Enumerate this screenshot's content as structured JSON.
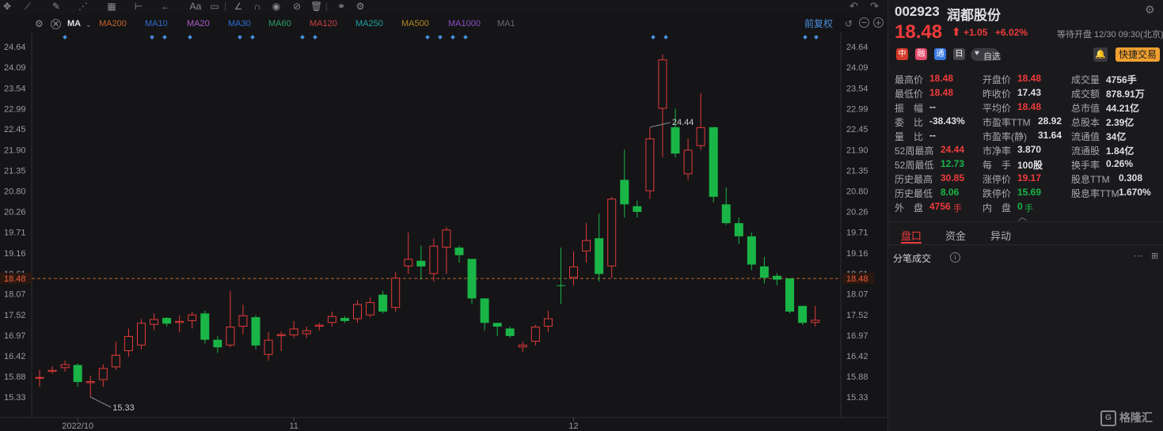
{
  "toolbar": {
    "icons": [
      "crosshair-icon",
      "line-icon",
      "pencil-icon",
      "polyline-icon",
      "range-icon",
      "arrow-icon",
      "measure-icon",
      "text-icon",
      "comment-icon",
      "brush-icon",
      "magnet-icon",
      "eye-icon",
      "hide-icon",
      "delete-icon",
      "link-icon",
      "settings-icon"
    ],
    "text_label": "Aa"
  },
  "ma_row": {
    "ma_select": "MA",
    "items": [
      {
        "label": "MA200",
        "color": "#c8642b"
      },
      {
        "label": "MA10",
        "color": "#2f6fd0"
      },
      {
        "label": "MA20",
        "color": "#a85fc8"
      },
      {
        "label": "MA30",
        "color": "#2f6fd0"
      },
      {
        "label": "MA60",
        "color": "#2f9f6a"
      },
      {
        "label": "MA120",
        "color": "#c84040"
      },
      {
        "label": "MA250",
        "color": "#1fa0a0"
      },
      {
        "label": "MA500",
        "color": "#b08a20"
      },
      {
        "label": "MA1000",
        "color": "#8a4fc8"
      },
      {
        "label": "MA1",
        "color": "#6a6a70"
      }
    ],
    "adjust_label": "前复权"
  },
  "chart_data": {
    "type": "candlestick",
    "y_ticks": [
      "24.64",
      "24.09",
      "23.54",
      "22.99",
      "22.45",
      "21.90",
      "21.35",
      "20.80",
      "20.26",
      "19.71",
      "19.16",
      "18.61",
      "18.07",
      "17.52",
      "16.97",
      "16.42",
      "15.88",
      "15.33"
    ],
    "ylim": [
      14.8,
      25.0
    ],
    "current_price_label": "18.48",
    "current_price": 18.48,
    "x_labels": [
      {
        "label": "2022/10",
        "index": 3
      },
      {
        "label": "11",
        "index": 20
      },
      {
        "label": "12",
        "index": 42
      }
    ],
    "annotations": [
      {
        "label": "15.33",
        "index": 4
      },
      {
        "label": "24.44",
        "index": 48
      }
    ],
    "candles": [
      {
        "o": 15.82,
        "c": 15.86,
        "h": 16.05,
        "l": 15.6
      },
      {
        "o": 16.0,
        "c": 16.05,
        "h": 16.15,
        "l": 15.95
      },
      {
        "o": 16.1,
        "c": 16.2,
        "h": 16.3,
        "l": 16.0
      },
      {
        "o": 16.18,
        "c": 15.73,
        "h": 16.22,
        "l": 15.6
      },
      {
        "o": 15.7,
        "c": 15.75,
        "h": 15.9,
        "l": 15.33
      },
      {
        "o": 15.78,
        "c": 16.1,
        "h": 16.2,
        "l": 15.6
      },
      {
        "o": 16.12,
        "c": 16.45,
        "h": 16.8,
        "l": 16.05
      },
      {
        "o": 16.55,
        "c": 16.95,
        "h": 17.15,
        "l": 16.4
      },
      {
        "o": 16.7,
        "c": 17.3,
        "h": 17.4,
        "l": 16.6
      },
      {
        "o": 17.25,
        "c": 17.4,
        "h": 17.55,
        "l": 17.1
      },
      {
        "o": 17.43,
        "c": 17.28,
        "h": 17.45,
        "l": 17.2
      },
      {
        "o": 17.3,
        "c": 17.35,
        "h": 17.5,
        "l": 17.05
      },
      {
        "o": 17.35,
        "c": 17.52,
        "h": 17.6,
        "l": 17.15
      },
      {
        "o": 17.55,
        "c": 16.85,
        "h": 17.62,
        "l": 16.75
      },
      {
        "o": 16.85,
        "c": 16.65,
        "h": 16.95,
        "l": 16.5
      },
      {
        "o": 16.7,
        "c": 17.2,
        "h": 18.15,
        "l": 16.65
      },
      {
        "o": 17.2,
        "c": 17.5,
        "h": 17.78,
        "l": 17.0
      },
      {
        "o": 17.45,
        "c": 16.7,
        "h": 17.5,
        "l": 16.6
      },
      {
        "o": 16.45,
        "c": 16.85,
        "h": 17.05,
        "l": 16.3
      },
      {
        "o": 16.95,
        "c": 17.0,
        "h": 17.07,
        "l": 16.55
      },
      {
        "o": 16.97,
        "c": 17.15,
        "h": 17.35,
        "l": 16.9
      },
      {
        "o": 17.0,
        "c": 17.1,
        "h": 17.2,
        "l": 16.9
      },
      {
        "o": 17.2,
        "c": 17.25,
        "h": 17.3,
        "l": 17.1
      },
      {
        "o": 17.3,
        "c": 17.48,
        "h": 17.6,
        "l": 17.2
      },
      {
        "o": 17.43,
        "c": 17.35,
        "h": 17.48,
        "l": 17.3
      },
      {
        "o": 17.4,
        "c": 17.8,
        "h": 17.9,
        "l": 17.3
      },
      {
        "o": 17.5,
        "c": 17.85,
        "h": 17.98,
        "l": 17.45
      },
      {
        "o": 18.05,
        "c": 17.6,
        "h": 18.15,
        "l": 17.55
      },
      {
        "o": 17.7,
        "c": 18.5,
        "h": 18.65,
        "l": 17.6
      },
      {
        "o": 18.8,
        "c": 19.0,
        "h": 19.7,
        "l": 18.6
      },
      {
        "o": 18.95,
        "c": 18.8,
        "h": 19.35,
        "l": 18.45
      },
      {
        "o": 18.6,
        "c": 19.35,
        "h": 19.55,
        "l": 18.4
      },
      {
        "o": 19.3,
        "c": 19.78,
        "h": 19.85,
        "l": 18.6
      },
      {
        "o": 19.3,
        "c": 19.1,
        "h": 19.35,
        "l": 18.9
      },
      {
        "o": 19.0,
        "c": 17.95,
        "h": 19.0,
        "l": 17.8
      },
      {
        "o": 17.95,
        "c": 17.3,
        "h": 17.95,
        "l": 17.1
      },
      {
        "o": 17.3,
        "c": 17.2,
        "h": 17.3,
        "l": 16.95
      },
      {
        "o": 17.15,
        "c": 16.95,
        "h": 17.2,
        "l": 16.9
      },
      {
        "o": 16.65,
        "c": 16.72,
        "h": 16.8,
        "l": 16.52
      },
      {
        "o": 16.8,
        "c": 17.2,
        "h": 17.25,
        "l": 16.7
      },
      {
        "o": 17.2,
        "c": 17.42,
        "h": 17.62,
        "l": 17.05
      },
      {
        "o": 18.3,
        "c": 18.28,
        "h": 19.3,
        "l": 17.8
      },
      {
        "o": 18.5,
        "c": 18.8,
        "h": 19.2,
        "l": 18.3
      },
      {
        "o": 19.2,
        "c": 19.5,
        "h": 19.95,
        "l": 18.9
      },
      {
        "o": 19.55,
        "c": 18.6,
        "h": 20.2,
        "l": 18.4
      },
      {
        "o": 18.8,
        "c": 20.6,
        "h": 20.65,
        "l": 18.5
      },
      {
        "o": 21.1,
        "c": 20.45,
        "h": 21.9,
        "l": 20.1
      },
      {
        "o": 20.4,
        "c": 20.25,
        "h": 20.55,
        "l": 20.1
      },
      {
        "o": 20.8,
        "c": 22.2,
        "h": 22.5,
        "l": 20.6
      },
      {
        "o": 22.99,
        "c": 24.3,
        "h": 24.44,
        "l": 21.7
      },
      {
        "o": 22.5,
        "c": 21.8,
        "h": 22.99,
        "l": 21.7
      },
      {
        "o": 21.25,
        "c": 21.9,
        "h": 22.2,
        "l": 21.1
      },
      {
        "o": 22.0,
        "c": 22.5,
        "h": 23.4,
        "l": 21.9
      },
      {
        "o": 22.5,
        "c": 20.65,
        "h": 22.5,
        "l": 20.5
      },
      {
        "o": 20.45,
        "c": 19.95,
        "h": 20.9,
        "l": 19.9
      },
      {
        "o": 19.95,
        "c": 19.6,
        "h": 20.1,
        "l": 19.4
      },
      {
        "o": 19.6,
        "c": 18.85,
        "h": 19.7,
        "l": 18.7
      },
      {
        "o": 18.8,
        "c": 18.5,
        "h": 19.05,
        "l": 18.35
      },
      {
        "o": 18.55,
        "c": 18.45,
        "h": 18.62,
        "l": 18.3
      },
      {
        "o": 18.48,
        "c": 17.6,
        "h": 18.48,
        "l": 17.55
      },
      {
        "o": 17.75,
        "c": 17.3,
        "h": 17.75,
        "l": 17.25
      },
      {
        "o": 17.3,
        "c": 17.38,
        "h": 17.75,
        "l": 17.2
      }
    ]
  },
  "stock": {
    "code": "002923",
    "name": "润都股份",
    "price": "18.48",
    "change": "+1.05",
    "change_pct": "+6.02%",
    "status": "等待开盘 12/30 09:30(北京)",
    "watchlist_label": "自选",
    "quick_trade_label": "快捷交易",
    "tags": [
      "中",
      "融",
      "通",
      "日"
    ]
  },
  "stats": {
    "col1": [
      {
        "label": "最高价",
        "value": "18.48",
        "color": "red"
      },
      {
        "label": "最低价",
        "value": "18.48",
        "color": "red"
      },
      {
        "label": "振　幅",
        "value": "--",
        "color": "white"
      },
      {
        "label": "委　比",
        "value": "-38.43%",
        "color": "white"
      },
      {
        "label": "量　比",
        "value": "--",
        "color": "white"
      },
      {
        "label": "52周最高",
        "value": "24.44",
        "color": "red"
      },
      {
        "label": "52周最低",
        "value": "12.73",
        "color": "green"
      },
      {
        "label": "历史最高",
        "value": "30.85",
        "color": "red"
      },
      {
        "label": "历史最低",
        "value": "8.06",
        "color": "green"
      },
      {
        "label": "外　盘",
        "value": "4756",
        "unit": "手",
        "color": "red"
      }
    ],
    "col2": [
      {
        "label": "开盘价",
        "value": "18.48",
        "color": "red"
      },
      {
        "label": "昨收价",
        "value": "17.43",
        "color": "white"
      },
      {
        "label": "平均价",
        "value": "18.48",
        "color": "red"
      },
      {
        "label": "市盈率TTM",
        "value": "28.92",
        "color": "white"
      },
      {
        "label": "市盈率(静)",
        "value": "31.64",
        "color": "white"
      },
      {
        "label": "市净率",
        "value": "3.870",
        "color": "white"
      },
      {
        "label": "每　手",
        "value": "100股",
        "color": "white"
      },
      {
        "label": "涨停价",
        "value": "19.17",
        "color": "red"
      },
      {
        "label": "跌停价",
        "value": "15.69",
        "color": "green"
      },
      {
        "label": "内　盘",
        "value": "0",
        "unit": "手",
        "color": "green"
      }
    ],
    "col3": [
      {
        "label": "成交量",
        "value": "4756手",
        "color": "white"
      },
      {
        "label": "成交额",
        "value": "878.91万",
        "color": "white"
      },
      {
        "label": "总市值",
        "value": "44.21亿",
        "color": "white"
      },
      {
        "label": "总股本",
        "value": "2.39亿",
        "color": "white"
      },
      {
        "label": "流通值",
        "value": "34亿",
        "color": "white"
      },
      {
        "label": "流通股",
        "value": "1.84亿",
        "color": "white"
      },
      {
        "label": "换手率",
        "value": "0.26%",
        "color": "white"
      },
      {
        "label": "股息TTM",
        "value": "0.308",
        "color": "white"
      },
      {
        "label": "股息率TTM",
        "value": "1.670%",
        "color": "white"
      }
    ]
  },
  "tabs": [
    {
      "label": "盘口",
      "active": true
    },
    {
      "label": "资金",
      "active": false
    },
    {
      "label": "异动",
      "active": false
    }
  ],
  "ticks_section": {
    "title": "分笔成交"
  },
  "watermark": "格隆汇"
}
